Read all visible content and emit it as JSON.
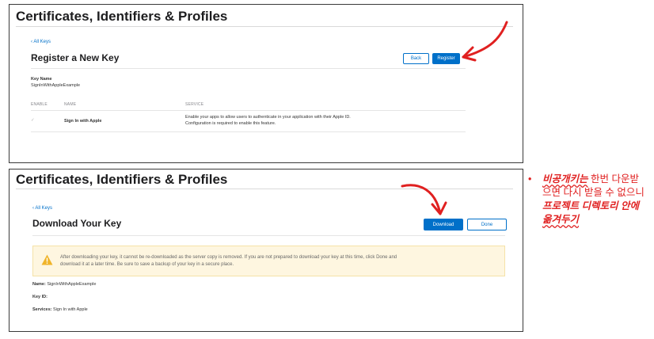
{
  "panel1": {
    "header": "Certificates, Identifiers & Profiles",
    "back_link": "‹ All Keys",
    "title": "Register a New Key",
    "back_button": "Back",
    "register_button": "Register",
    "key_name_label": "Key Name",
    "key_name_value": "SignInWithAppleExample",
    "columns": [
      "ENABLE",
      "NAME",
      "SERVICE"
    ],
    "service_name": "Sign In with Apple",
    "service_desc_1": "Enable your apps to allow users to authenticate in your application with their Apple ID.",
    "service_desc_2": "Configuration is required to enable this feature.",
    "check_glyph": "✓"
  },
  "panel2": {
    "header": "Certificates, Identifiers & Profiles",
    "back_link": "‹ All Keys",
    "title": "Download Your Key",
    "download_button": "Download",
    "done_button": "Done",
    "warning_text": "After downloading your key, it cannot be re-downloaded as the server copy is removed. If you are not prepared to download your key at this time, click Done and download it at a later time. Be sure to save a backup of your key in a secure place.",
    "name_label": "Name:",
    "name_value": "SignInWithAppleExample",
    "keyid_label": "Key ID:",
    "keyid_value": "",
    "services_label": "Services:",
    "services_value": "Sign In with Apple"
  },
  "annotation": {
    "bullet": "•",
    "part1": "비공개키는",
    "part2": " 한번 다운받으면 다시 받을 수 없으니 ",
    "part3": "프로젝트 디렉토리 안에 ",
    "part4": "옮겨두기"
  },
  "colors": {
    "accent": "#0070c9",
    "annotation": "#e02020",
    "warning_bg": "#fef6e0",
    "warning_icon": "#f0b429"
  }
}
